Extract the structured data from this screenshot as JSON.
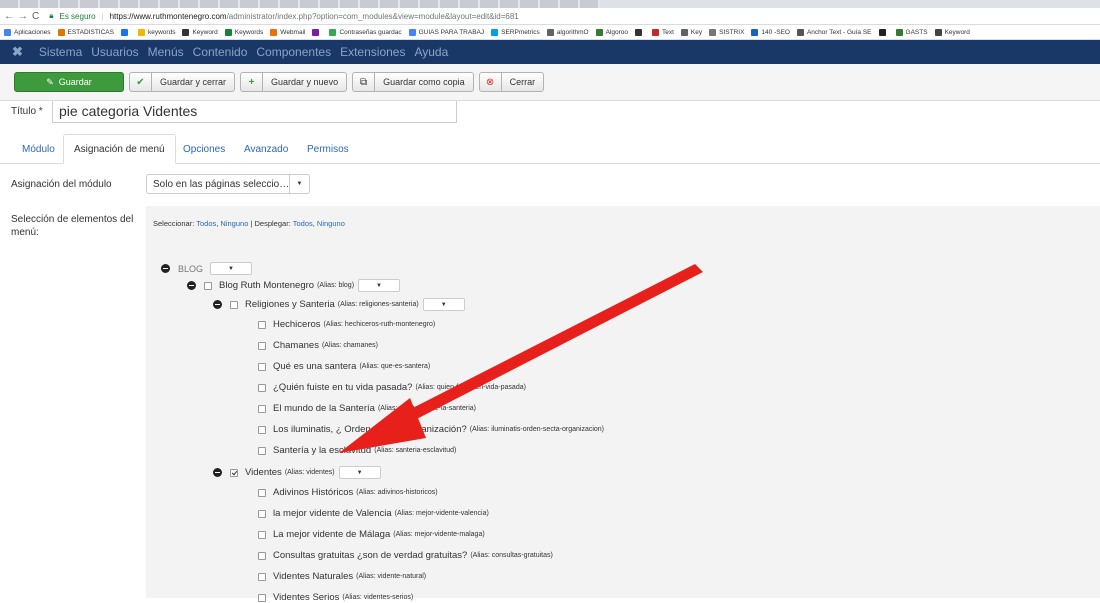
{
  "browser": {
    "secure_label": "Es seguro",
    "url_host": "https://www.ruthmontenegro.com",
    "url_path": "/administrator/index.php?option=com_modules&view=module&layout=edit&id=681",
    "bookmarks": [
      "Aplicaciones",
      "ESTADISTICAS",
      "",
      "keywords",
      "Keyword",
      "Keywords",
      "Webmail",
      "",
      "Contraseñas guardac",
      "GUIAS PARA TRABAJ",
      "SERPmetrics",
      "algorithmO",
      "Algoroo",
      "",
      "Text",
      "Key",
      "SISTRIX",
      "140 -SEO",
      "Anchor Text - Guía SE",
      "",
      "GASTS",
      "Keyword"
    ]
  },
  "topmenu": {
    "items": [
      "Sistema",
      "Usuarios",
      "Menús",
      "Contenido",
      "Componentes",
      "Extensiones",
      "Ayuda"
    ]
  },
  "toolbar": {
    "save": "Guardar",
    "save_close": "Guardar y cerrar",
    "save_new": "Guardar y nuevo",
    "save_copy": "Guardar como copia",
    "close": "Cerrar"
  },
  "form": {
    "title_label": "Título *",
    "title_value": "pie categoria Videntes"
  },
  "tabs": [
    "Módulo",
    "Asignación de menú",
    "Opciones",
    "Avanzado",
    "Permisos"
  ],
  "assignment": {
    "label": "Asignación del módulo",
    "value": "Solo en las páginas seleccio…",
    "selection_label": "Selección de elementos del menú:",
    "select_text": "Seleccionar:",
    "select_all": "Todos",
    "select_none": "Ninguno",
    "expand_text": "Desplegar:",
    "expand_all": "Todos",
    "expand_none": "Ninguno"
  },
  "tree": {
    "menu_name": "BLOG",
    "root": {
      "title": "Blog Ruth Montenegro",
      "alias": "(Alias: blog)"
    },
    "cat1": {
      "title": "Religiones y Santeria",
      "alias": "(Alias: religiones-santeria)"
    },
    "cat1_items": [
      {
        "title": "Hechiceros",
        "alias": "(Alias: hechiceros-ruth-montenegro)"
      },
      {
        "title": "Chamanes",
        "alias": "(Alias: chamanes)"
      },
      {
        "title": "Qué es una santera",
        "alias": "(Alias: que-es-santera)"
      },
      {
        "title": "¿Quién fuiste en tu vida pasada?",
        "alias": "(Alias: quien-fuiste-en-vida-pasada)"
      },
      {
        "title": "El mundo de la Santería",
        "alias": "(Alias: el-mundo-de-la-santeria)"
      },
      {
        "title": "Los iluminatis, ¿ Orden, Secta, Organización?",
        "alias": "(Alias: iluminatis-orden-secta-organizacion)"
      },
      {
        "title": "Santería y la esclavitud",
        "alias": "(Alias: santeria-esclavitud)"
      }
    ],
    "cat2": {
      "title": "Videntes",
      "alias": "(Alias: videntes)"
    },
    "cat2_items": [
      {
        "title": "Adivinos Históricos",
        "alias": "(Alias: adivinos-historicos)"
      },
      {
        "title": "la mejor vidente de Valencia",
        "alias": "(Alias: mejor-vidente-valencia)"
      },
      {
        "title": "La mejor vidente de Málaga",
        "alias": "(Alias: mejor-vidente-malaga)"
      },
      {
        "title": "Consultas gratuitas ¿son de verdad gratuitas?",
        "alias": "(Alias: consultas-gratuitas)"
      },
      {
        "title": "Videntes Naturales",
        "alias": "(Alias: vidente-natural)"
      },
      {
        "title": "Videntes Serios",
        "alias": "(Alias: videntes-serios)"
      }
    ]
  },
  "colors": {
    "topmenu_bg": "#1a3867",
    "save_green": "#3d9b3d",
    "link_blue": "#2a69b8",
    "arrow_red": "#e8201b"
  }
}
